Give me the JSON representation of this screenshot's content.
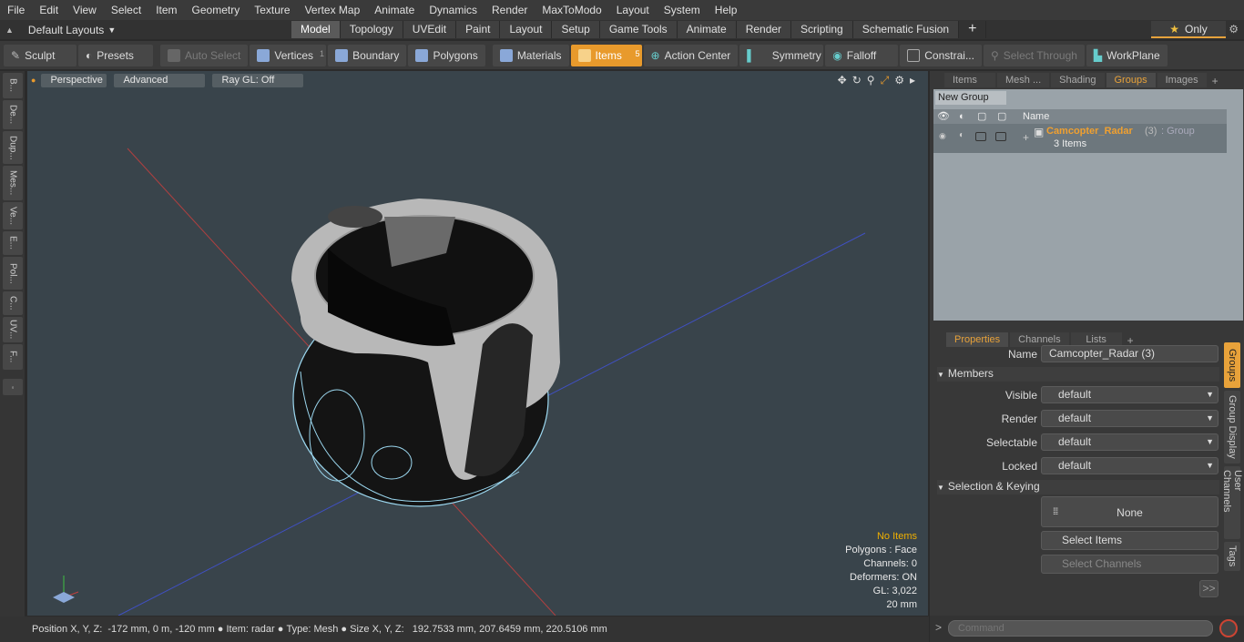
{
  "menu": [
    "File",
    "Edit",
    "View",
    "Select",
    "Item",
    "Geometry",
    "Texture",
    "Vertex Map",
    "Animate",
    "Dynamics",
    "Render",
    "MaxToModo",
    "Layout",
    "System",
    "Help"
  ],
  "layout_dropdown": "Default Layouts",
  "layout_tabs": [
    "Model",
    "Topology",
    "UVEdit",
    "Paint",
    "Layout",
    "Setup",
    "Game Tools",
    "Animate",
    "Render",
    "Scripting",
    "Schematic Fusion"
  ],
  "active_layout_tab": "Model",
  "only_label": "Only",
  "toolbar": {
    "sculpt": "Sculpt",
    "presets": "Presets",
    "auto_select": "Auto Select",
    "vertices": "Vertices",
    "vertices_count": "1",
    "boundary": "Boundary",
    "polygons": "Polygons",
    "materials": "Materials",
    "items": "Items",
    "items_count": "5",
    "action_center": "Action Center",
    "symmetry": "Symmetry",
    "falloff": "Falloff",
    "constraints": "Constrai...",
    "select_through": "Select Through",
    "workplane": "WorkPlane"
  },
  "left_tabs": [
    "B...",
    "De...",
    "Dup...",
    "Mes...",
    "Ve...",
    "E...",
    "Pol...",
    "C...",
    "UV...",
    "F..."
  ],
  "viewport": {
    "perspective": "Perspective",
    "advanced": "Advanced",
    "raygl": "Ray GL: Off",
    "stats": {
      "no_items": "No Items",
      "polygons": "Polygons : Face",
      "channels": "Channels: 0",
      "deformers": "Deformers: ON",
      "gl": "GL: 3,022",
      "scale": "20 mm"
    }
  },
  "statusbar": {
    "position_label": "Position X, Y, Z:",
    "position_value": "-172 mm, 0 m, -120 mm",
    "item_label": "Item:",
    "item_value": "radar",
    "type_label": "Type:",
    "type_value": "Mesh",
    "size_label": "Size X, Y, Z:",
    "size_value": "192.7533 mm, 207.6459 mm, 220.5106 mm"
  },
  "right_top_tabs": [
    "Items",
    "Mesh ...",
    "Shading",
    "Groups",
    "Images"
  ],
  "active_right_top_tab": "Groups",
  "groups": {
    "new_group": "New Group",
    "name_header": "Name",
    "row_name": "Camcopter_Radar",
    "row_count": "(3)",
    "row_type": ": Group",
    "row_sub": "3 Items"
  },
  "props_tabs": [
    "Properties",
    "Channels",
    "Lists"
  ],
  "active_props_tab": "Properties",
  "properties": {
    "name_label": "Name",
    "name_value": "Camcopter_Radar (3)",
    "members_section": "Members",
    "fields": [
      {
        "label": "Visible",
        "value": "default"
      },
      {
        "label": "Render",
        "value": "default"
      },
      {
        "label": "Selectable",
        "value": "default"
      },
      {
        "label": "Locked",
        "value": "default"
      }
    ],
    "selection_section": "Selection & Keying",
    "none_label": "None",
    "select_items": "Select Items",
    "select_channels": "Select Channels",
    "more": ">>"
  },
  "side_tabs": [
    "Groups",
    "Group Display",
    "User Channels",
    "Tags"
  ],
  "command_placeholder": "Command",
  "colors": {
    "accent": "#e89a2c",
    "viewport_bg": "#39444b",
    "selection_text": "#f0a030"
  }
}
